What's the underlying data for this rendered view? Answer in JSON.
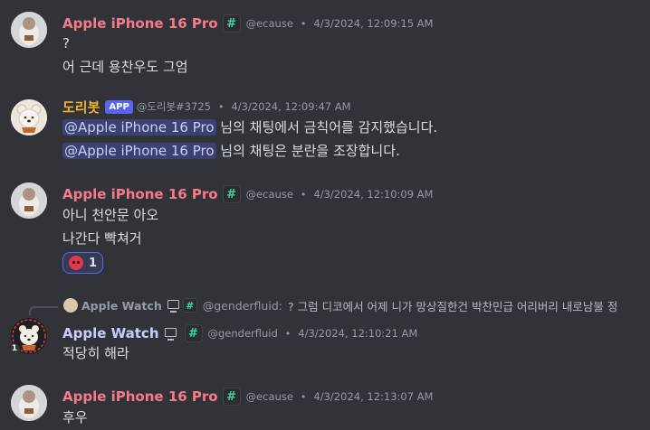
{
  "messages": {
    "m1": {
      "username": "Apple iPhone 16 Pro",
      "tag": "#",
      "handle": "@ecause",
      "dot": "•",
      "timestamp": "4/3/2024, 12:09:15 AM",
      "lines": [
        "?",
        "어 근데 용찬우도 그엄"
      ]
    },
    "m2": {
      "username": "도리봇",
      "badge": "APP",
      "handle": "@도리봇#3725",
      "dot": "•",
      "timestamp": "4/3/2024, 12:09:47 AM",
      "mention": "@Apple iPhone 16 Pro",
      "line1_rest": " 님의 채팅에서 금칙어를 감지했습니다.",
      "line2_rest": " 님의 채팅은 분란을 조장합니다."
    },
    "m3": {
      "username": "Apple iPhone 16 Pro",
      "tag": "#",
      "handle": "@ecause",
      "dot": "•",
      "timestamp": "4/3/2024, 12:10:09 AM",
      "lines": [
        "아니 천안문 아오",
        "나간다 빡쳐거"
      ],
      "reaction_count": "1"
    },
    "m4": {
      "reply": {
        "name": "Apple Watch",
        "tag": "#",
        "handle": "@genderfluid:",
        "text": "? 그럼 디코에서  어제 니가 망상질한건  박찬민급 어리버리 내로남불 정"
      },
      "username": "Apple Watch",
      "tag": "#",
      "handle": "@genderfluid",
      "dot": "•",
      "timestamp": "4/3/2024, 12:10:21 AM",
      "lines": [
        "적당히 해라"
      ],
      "avatar_badge": "1"
    },
    "m5": {
      "username": "Apple iPhone 16 Pro",
      "tag": "#",
      "handle": "@ecause",
      "dot": "•",
      "timestamp": "4/3/2024, 12:13:07 AM",
      "lines": [
        "후우"
      ]
    }
  },
  "colors": {
    "background": "#313338",
    "iphone_name": "#f47b88",
    "bot_name": "#f0b232",
    "watch_name": "#c9cdfb",
    "tag_green": "#3ad6a0",
    "mention_bg": "#3c4270"
  },
  "icons": {
    "tag": "hash-tag-icon",
    "reaction": "angry-face-icon",
    "platform": "monitor-icon"
  }
}
